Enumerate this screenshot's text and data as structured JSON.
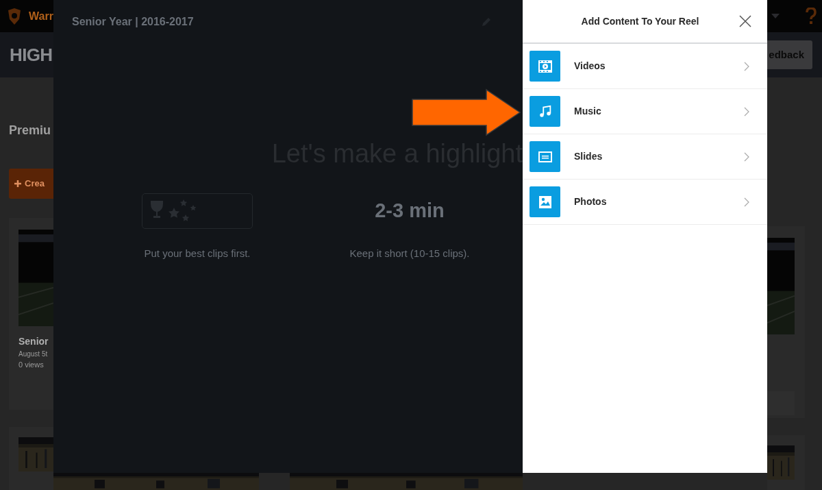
{
  "background_page": {
    "brand": "Warr",
    "header_title": "HIGH",
    "feedback_button": "edback",
    "section_title": "Premiu",
    "create_button": "Crea",
    "card": {
      "title": "Senior",
      "date": "August 5t",
      "views": "0 views"
    }
  },
  "reel_editor": {
    "title": "Senior Year | 2016-2017",
    "heading": "Let's make a highlight",
    "tips": [
      {
        "kind": "icon",
        "caption": "Put your best clips first."
      },
      {
        "kind": "text",
        "value": "2-3 min",
        "caption": "Keep it short (10-15 clips)."
      }
    ]
  },
  "add_content_panel": {
    "title": "Add Content To Your Reel",
    "items": [
      {
        "kind": "videos",
        "label": "Videos"
      },
      {
        "kind": "music",
        "label": "Music"
      },
      {
        "kind": "slides",
        "label": "Slides"
      },
      {
        "kind": "photos",
        "label": "Photos"
      }
    ]
  }
}
